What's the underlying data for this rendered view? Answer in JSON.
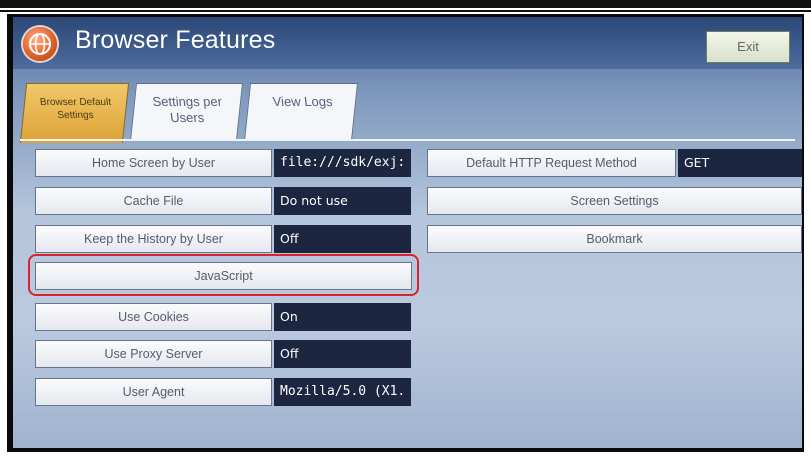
{
  "header": {
    "title": "Browser Features",
    "exit_label": "Exit"
  },
  "tabs": [
    {
      "label_line1": "Browser Default",
      "label_line2": "Settings",
      "active": true
    },
    {
      "label_line1": "Settings per",
      "label_line2": "Users",
      "active": false
    },
    {
      "label_line1": "View Logs",
      "label_line2": "",
      "active": false
    }
  ],
  "left_settings": {
    "home_screen": {
      "label": "Home Screen by User",
      "value": "file:///sdk/exj:"
    },
    "cache_file": {
      "label": "Cache File",
      "value": "Do not use"
    },
    "keep_history": {
      "label": "Keep the History by User",
      "value": "Off"
    },
    "javascript": {
      "label": "JavaScript"
    },
    "use_cookies": {
      "label": "Use Cookies",
      "value": "On"
    },
    "use_proxy": {
      "label": "Use Proxy Server",
      "value": "Off"
    },
    "user_agent": {
      "label": "User Agent",
      "value": "Mozilla/5.0 (X1."
    }
  },
  "right_settings": {
    "http_method": {
      "label": "Default HTTP Request Method",
      "value": "GET"
    },
    "screen_settings": {
      "label": "Screen Settings"
    },
    "bookmark": {
      "label": "Bookmark"
    }
  },
  "colors": {
    "highlight": "#d8242a",
    "active_tab": "#dca236",
    "value_bg": "#1d2640"
  }
}
